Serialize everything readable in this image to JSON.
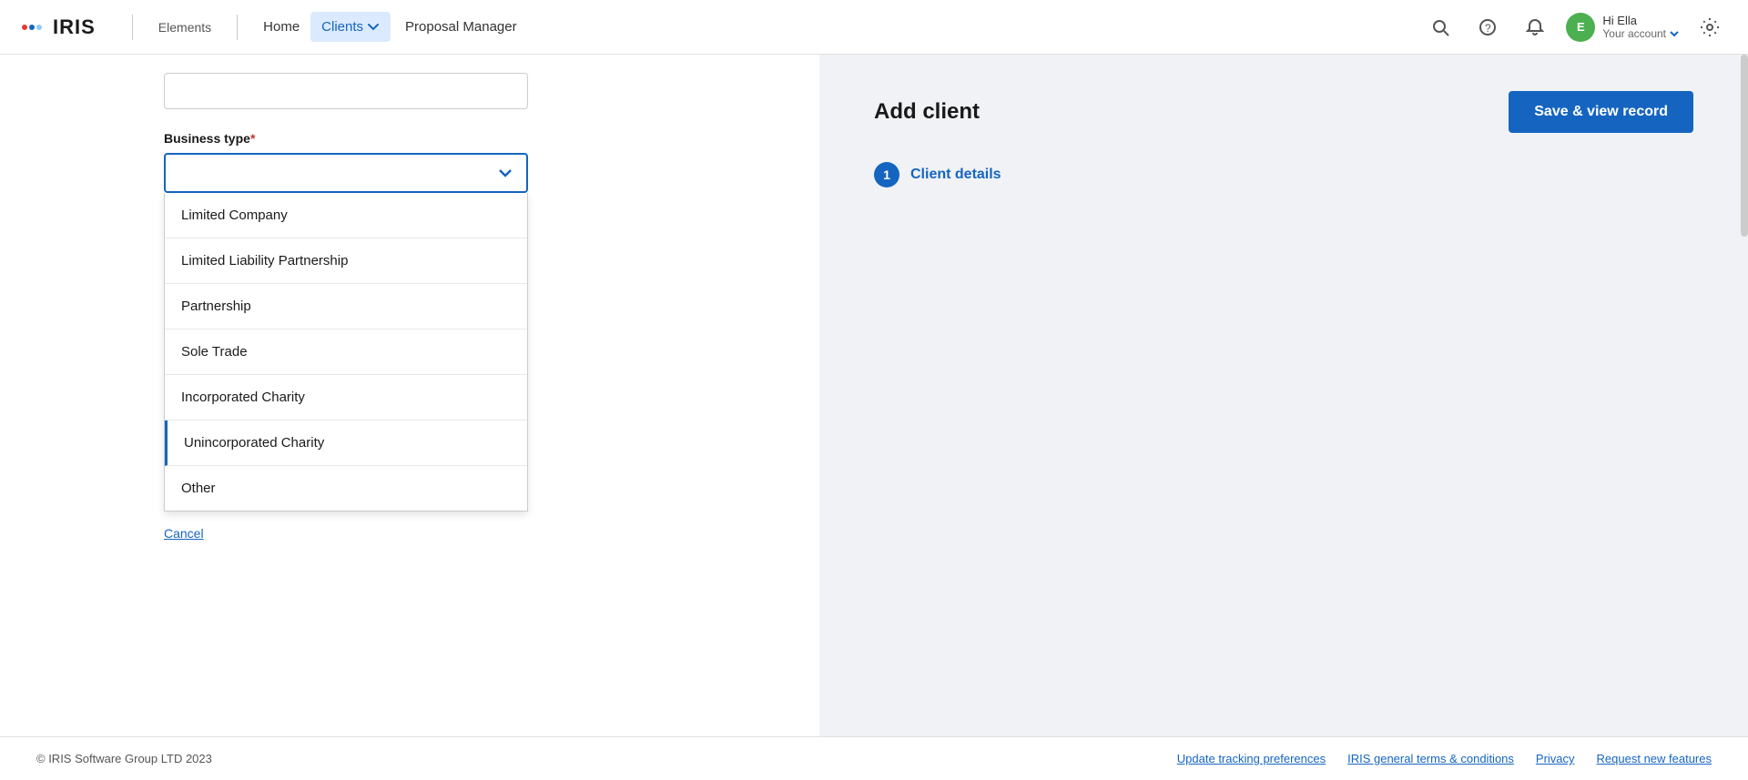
{
  "navbar": {
    "logo_text": "IRIS",
    "elements_label": "Elements",
    "home_label": "Home",
    "clients_label": "Clients",
    "proposal_manager_label": "Proposal Manager"
  },
  "user": {
    "greeting": "Hi Ella",
    "account_label": "Your account",
    "initials": "E"
  },
  "form": {
    "business_type_label": "Business type",
    "required_marker": "*",
    "dropdown_placeholder": "",
    "dropdown_options": [
      {
        "id": "limited_company",
        "label": "Limited Company"
      },
      {
        "id": "limited_liability_partnership",
        "label": "Limited Liability Partnership"
      },
      {
        "id": "partnership",
        "label": "Partnership"
      },
      {
        "id": "sole_trade",
        "label": "Sole Trade"
      },
      {
        "id": "incorporated_charity",
        "label": "Incorporated Charity"
      },
      {
        "id": "unincorporated_charity",
        "label": "Unincorporated Charity"
      },
      {
        "id": "other",
        "label": "Other"
      }
    ],
    "cancel_label": "Cancel"
  },
  "sidebar": {
    "title": "Add client",
    "save_button_label": "Save & view record",
    "step_number": "1",
    "client_details_label": "Client details"
  },
  "footer": {
    "copyright": "© IRIS Software Group LTD 2023",
    "links": [
      {
        "id": "tracking",
        "label": "Update tracking preferences"
      },
      {
        "id": "terms",
        "label": "IRIS general terms & conditions"
      },
      {
        "id": "privacy",
        "label": "Privacy"
      },
      {
        "id": "features",
        "label": "Request new features"
      }
    ]
  }
}
